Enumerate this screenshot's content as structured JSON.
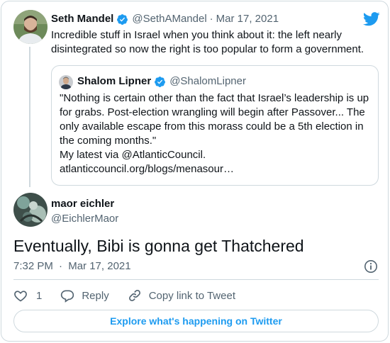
{
  "colors": {
    "accent": "#1d9bf0",
    "text_primary": "#0f1419",
    "text_secondary": "#536471",
    "border": "#cfd9de"
  },
  "parent_tweet": {
    "author_name": "Seth Mandel",
    "handle": "@SethAMandel",
    "date": "Mar 17, 2021",
    "text": "Incredible stuff in Israel when you think about it: the left nearly disintegrated so now the right is too popular to form a government.",
    "verified_icon": "verified-badge-icon",
    "quoted_tweet": {
      "author_name": "Shalom Lipner",
      "handle": "@ShalomLipner",
      "text_lines": [
        "\"Nothing is certain other than the fact that Israel’s leadership is up for grabs. Post-election wrangling will begin after Passover... The only available escape from this morass could be a 5th election in the coming months.\"",
        "My latest via @AtlanticCouncil.",
        "atlanticcouncil.org/blogs/menasour…"
      ]
    }
  },
  "main_tweet": {
    "author_name": "maor eichler",
    "handle": "@EichlerMaor",
    "text": "Eventually, Bibi is gonna get Thatchered",
    "time": "7:32 PM",
    "date": "Mar 17, 2021"
  },
  "actions": {
    "like_count": "1",
    "reply_label": "Reply",
    "copy_link_label": "Copy link to Tweet"
  },
  "explore_label": "Explore what's happening on Twitter",
  "icons": {
    "logo": "twitter-bird-icon",
    "info": "info-icon",
    "like": "heart-icon",
    "reply": "reply-bubble-icon",
    "copy_link": "link-icon"
  }
}
